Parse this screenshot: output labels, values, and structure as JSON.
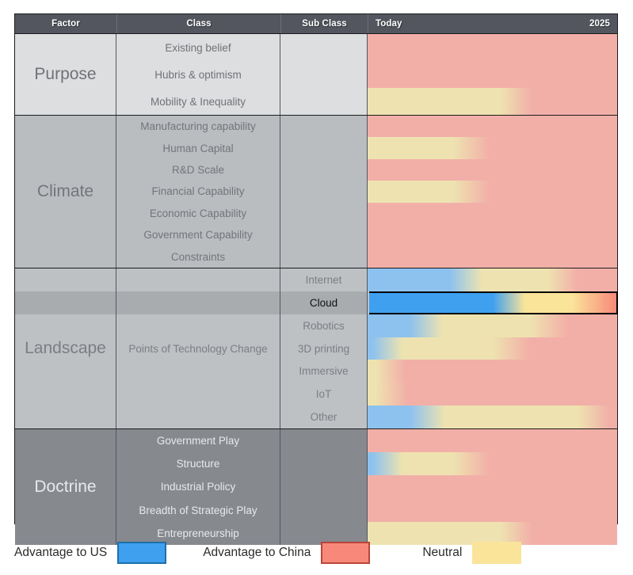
{
  "header": {
    "columns": [
      "Factor",
      "Class",
      "Sub Class"
    ],
    "timeline_start": "Today",
    "timeline_end": "2025"
  },
  "legend": {
    "items": [
      {
        "label": "Advantage to US",
        "color": "#3fa0ef"
      },
      {
        "label": "Advantage to China",
        "color": "#f8897a"
      },
      {
        "label": "Neutral",
        "color": "#fae49a"
      }
    ]
  },
  "palette": {
    "us_blue": "#3fa0ef",
    "us_blue_muted": "#8dc2ef",
    "china_red": "#f8897a",
    "china_red_muted": "#f2afa8",
    "neutral_yellow": "#fae49a",
    "neutral_yellow_muted": "#eee3b0",
    "header_bg": "#53565e",
    "grid_line": "#1c1c1c"
  },
  "groups": [
    {
      "factor": "Purpose",
      "tone": "tone-purpose",
      "classes": [
        {
          "label": "Existing belief",
          "sub": "",
          "bar": "all-red"
        },
        {
          "label": "Hubris & optimism",
          "sub": "",
          "bar": "all-red"
        },
        {
          "label": "Mobility & Inequality",
          "sub": "",
          "bar": "yellow-to-red-63"
        }
      ]
    },
    {
      "factor": "Climate",
      "tone": "tone-climate",
      "classes": [
        {
          "label": "Manufacturing capability",
          "sub": "",
          "bar": "all-red"
        },
        {
          "label": "Human Capital",
          "sub": "",
          "bar": "yellow-to-red-46"
        },
        {
          "label": "R&D Scale",
          "sub": "",
          "bar": "all-red"
        },
        {
          "label": "Financial Capability",
          "sub": "",
          "bar": "yellow-to-red-46"
        },
        {
          "label": "Economic Capability",
          "sub": "",
          "bar": "all-red"
        },
        {
          "label": "Government Capability",
          "sub": "",
          "bar": "all-red"
        },
        {
          "label": "Constraints",
          "sub": "",
          "bar": "all-red"
        }
      ]
    },
    {
      "factor": "Landscape",
      "tone": "tone-landscape",
      "class_merged": "Points of Technology Change",
      "classes": [
        {
          "label": "",
          "sub": "Internet",
          "bar": "blue-yellow-red-internet",
          "highlight": false
        },
        {
          "label": "",
          "sub": "Cloud",
          "bar": "blue-yellow-red-cloud",
          "highlight": true
        },
        {
          "label": "",
          "sub": "Robotics",
          "bar": "blue-yellow-red-robotics",
          "highlight": false
        },
        {
          "label": "",
          "sub": "3D printing",
          "bar": "blue-yellow-red-3dprint",
          "highlight": false
        },
        {
          "label": "",
          "sub": "Immersive",
          "bar": "yellow-red-immersive",
          "highlight": false
        },
        {
          "label": "",
          "sub": "IoT",
          "bar": "yellow-red-iot",
          "highlight": false
        },
        {
          "label": "",
          "sub": "Other",
          "bar": "blue-yellow-other",
          "highlight": false
        }
      ]
    },
    {
      "factor": "Doctrine",
      "tone": "tone-doctrine",
      "classes": [
        {
          "label": "Government Play",
          "sub": "",
          "bar": "all-red"
        },
        {
          "label": "Structure",
          "sub": "",
          "bar": "blue-yellow-red-structure"
        },
        {
          "label": "Industrial Policy",
          "sub": "",
          "bar": "all-red"
        },
        {
          "label": "Breadth of Strategic Play",
          "sub": "",
          "bar": "all-red"
        },
        {
          "label": "Entrepreneurship",
          "sub": "",
          "bar": "yellow-to-red-63"
        }
      ]
    }
  ],
  "chart_data": {
    "type": "heatmap",
    "title": "",
    "xlabel": "",
    "ylabel": "",
    "x_axis": {
      "start": "Today",
      "end": "2025"
    },
    "legend_position": "bottom",
    "grid": true,
    "value_scale": [
      {
        "name": "Advantage to US",
        "color": "#3fa0ef"
      },
      {
        "name": "Neutral",
        "color": "#fae49a"
      },
      {
        "name": "Advantage to China",
        "color": "#f8897a"
      }
    ],
    "rows": [
      {
        "factor": "Purpose",
        "class": "Existing belief",
        "sub_class": "",
        "stops": [
          {
            "pos": 0,
            "state": "china"
          },
          {
            "pos": 100,
            "state": "china"
          }
        ]
      },
      {
        "factor": "Purpose",
        "class": "Hubris & optimism",
        "sub_class": "",
        "stops": [
          {
            "pos": 0,
            "state": "china"
          },
          {
            "pos": 100,
            "state": "china"
          }
        ]
      },
      {
        "factor": "Purpose",
        "class": "Mobility & Inequality",
        "sub_class": "",
        "stops": [
          {
            "pos": 0,
            "state": "neutral"
          },
          {
            "pos": 53,
            "state": "neutral"
          },
          {
            "pos": 66,
            "state": "china"
          },
          {
            "pos": 100,
            "state": "china"
          }
        ]
      },
      {
        "factor": "Climate",
        "class": "Manufacturing capability",
        "sub_class": "",
        "stops": [
          {
            "pos": 0,
            "state": "china"
          },
          {
            "pos": 100,
            "state": "china"
          }
        ]
      },
      {
        "factor": "Climate",
        "class": "Human Capital",
        "sub_class": "",
        "stops": [
          {
            "pos": 0,
            "state": "neutral"
          },
          {
            "pos": 34,
            "state": "neutral"
          },
          {
            "pos": 49,
            "state": "china"
          },
          {
            "pos": 100,
            "state": "china"
          }
        ]
      },
      {
        "factor": "Climate",
        "class": "R&D Scale",
        "sub_class": "",
        "stops": [
          {
            "pos": 0,
            "state": "china"
          },
          {
            "pos": 100,
            "state": "china"
          }
        ]
      },
      {
        "factor": "Climate",
        "class": "Financial Capability",
        "sub_class": "",
        "stops": [
          {
            "pos": 0,
            "state": "neutral"
          },
          {
            "pos": 34,
            "state": "neutral"
          },
          {
            "pos": 49,
            "state": "china"
          },
          {
            "pos": 100,
            "state": "china"
          }
        ]
      },
      {
        "factor": "Climate",
        "class": "Economic Capability",
        "sub_class": "",
        "stops": [
          {
            "pos": 0,
            "state": "china"
          },
          {
            "pos": 100,
            "state": "china"
          }
        ]
      },
      {
        "factor": "Climate",
        "class": "Government Capability",
        "sub_class": "",
        "stops": [
          {
            "pos": 0,
            "state": "china"
          },
          {
            "pos": 100,
            "state": "china"
          }
        ]
      },
      {
        "factor": "Climate",
        "class": "Constraints",
        "sub_class": "",
        "stops": [
          {
            "pos": 0,
            "state": "china"
          },
          {
            "pos": 100,
            "state": "china"
          }
        ]
      },
      {
        "factor": "Landscape",
        "class": "Points of Technology Change",
        "sub_class": "Internet",
        "stops": [
          {
            "pos": 0,
            "state": "us"
          },
          {
            "pos": 33,
            "state": "us"
          },
          {
            "pos": 46,
            "state": "neutral"
          },
          {
            "pos": 72,
            "state": "neutral"
          },
          {
            "pos": 84,
            "state": "china"
          },
          {
            "pos": 100,
            "state": "china"
          }
        ]
      },
      {
        "factor": "Landscape",
        "class": "Points of Technology Change",
        "sub_class": "Cloud",
        "highlighted": true,
        "stops": [
          {
            "pos": 0,
            "state": "us"
          },
          {
            "pos": 50,
            "state": "us"
          },
          {
            "pos": 63,
            "state": "neutral"
          },
          {
            "pos": 82,
            "state": "neutral"
          },
          {
            "pos": 100,
            "state": "china"
          }
        ]
      },
      {
        "factor": "Landscape",
        "class": "Points of Technology Change",
        "sub_class": "Robotics",
        "stops": [
          {
            "pos": 0,
            "state": "us"
          },
          {
            "pos": 17,
            "state": "us"
          },
          {
            "pos": 30,
            "state": "neutral"
          },
          {
            "pos": 65,
            "state": "neutral"
          },
          {
            "pos": 80,
            "state": "china"
          },
          {
            "pos": 100,
            "state": "china"
          }
        ]
      },
      {
        "factor": "Landscape",
        "class": "Points of Technology Change",
        "sub_class": "3D printing",
        "stops": [
          {
            "pos": 0,
            "state": "us"
          },
          {
            "pos": 2,
            "state": "us"
          },
          {
            "pos": 14,
            "state": "neutral"
          },
          {
            "pos": 50,
            "state": "neutral"
          },
          {
            "pos": 65,
            "state": "china"
          },
          {
            "pos": 100,
            "state": "china"
          }
        ]
      },
      {
        "factor": "Landscape",
        "class": "Points of Technology Change",
        "sub_class": "Immersive",
        "stops": [
          {
            "pos": 0,
            "state": "neutral"
          },
          {
            "pos": 3,
            "state": "neutral"
          },
          {
            "pos": 15,
            "state": "china"
          },
          {
            "pos": 100,
            "state": "china"
          }
        ]
      },
      {
        "factor": "Landscape",
        "class": "Points of Technology Change",
        "sub_class": "IoT",
        "stops": [
          {
            "pos": 0,
            "state": "neutral"
          },
          {
            "pos": 3,
            "state": "neutral"
          },
          {
            "pos": 16,
            "state": "china"
          },
          {
            "pos": 100,
            "state": "china"
          }
        ]
      },
      {
        "factor": "Landscape",
        "class": "Points of Technology Change",
        "sub_class": "Other",
        "stops": [
          {
            "pos": 0,
            "state": "us"
          },
          {
            "pos": 17,
            "state": "us"
          },
          {
            "pos": 31,
            "state": "neutral"
          },
          {
            "pos": 84,
            "state": "neutral"
          },
          {
            "pos": 97,
            "state": "china"
          },
          {
            "pos": 100,
            "state": "china"
          }
        ]
      },
      {
        "factor": "Doctrine",
        "class": "Government Play",
        "sub_class": "",
        "stops": [
          {
            "pos": 0,
            "state": "china"
          },
          {
            "pos": 100,
            "state": "china"
          }
        ]
      },
      {
        "factor": "Doctrine",
        "class": "Structure",
        "sub_class": "",
        "stops": [
          {
            "pos": 0,
            "state": "us"
          },
          {
            "pos": 2,
            "state": "us"
          },
          {
            "pos": 14,
            "state": "neutral"
          },
          {
            "pos": 34,
            "state": "neutral"
          },
          {
            "pos": 49,
            "state": "china"
          },
          {
            "pos": 100,
            "state": "china"
          }
        ]
      },
      {
        "factor": "Doctrine",
        "class": "Industrial Policy",
        "sub_class": "",
        "stops": [
          {
            "pos": 0,
            "state": "china"
          },
          {
            "pos": 100,
            "state": "china"
          }
        ]
      },
      {
        "factor": "Doctrine",
        "class": "Breadth of Strategic Play",
        "sub_class": "",
        "stops": [
          {
            "pos": 0,
            "state": "china"
          },
          {
            "pos": 100,
            "state": "china"
          }
        ]
      },
      {
        "factor": "Doctrine",
        "class": "Entrepreneurship",
        "sub_class": "",
        "stops": [
          {
            "pos": 0,
            "state": "neutral"
          },
          {
            "pos": 53,
            "state": "neutral"
          },
          {
            "pos": 66,
            "state": "china"
          },
          {
            "pos": 100,
            "state": "china"
          }
        ]
      }
    ]
  }
}
